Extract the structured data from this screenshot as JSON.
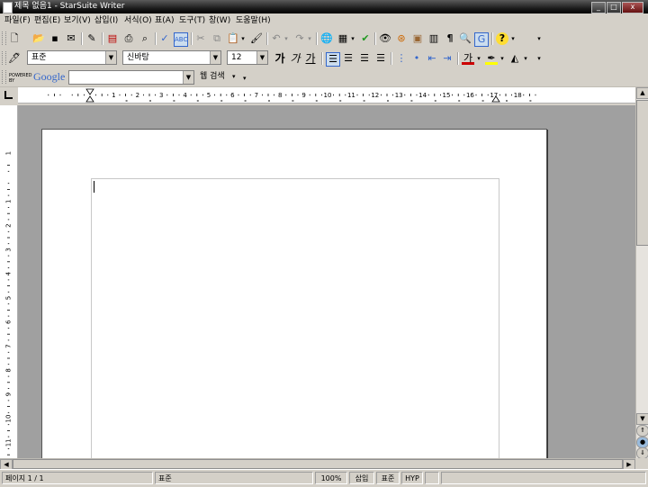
{
  "window": {
    "title": "제목 없음1 - StarSuite Writer"
  },
  "menu": [
    "파일(F)",
    "편집(E)",
    "보기(V)",
    "삽입(I)",
    "서식(O)",
    "표(A)",
    "도구(T)",
    "창(W)",
    "도움말(H)"
  ],
  "format_bar": {
    "style_value": "표준",
    "font_value": "신바탕",
    "size_value": "12",
    "bold_label": "가",
    "italic_label": "가",
    "underline_label": "가"
  },
  "google_bar": {
    "powered_label": "POWERED BY",
    "google_label": "Google",
    "search_value": "",
    "search_button_label": "웹 검색"
  },
  "hruler_labels": [
    "1",
    "2",
    "3",
    "4",
    "5",
    "6",
    "7",
    "8",
    "9",
    "10",
    "11",
    "12",
    "13",
    "14",
    "15",
    "16",
    "17",
    "18"
  ],
  "vruler_labels": [
    "1",
    "1",
    "2",
    "3",
    "4",
    "5",
    "6",
    "7",
    "8",
    "9",
    "10",
    "11"
  ],
  "status": {
    "page": "페이지 1 / 1",
    "style": "표준",
    "zoom": "100%",
    "insert_mode": "삽입",
    "selection_mode": "표준",
    "hyphen": "HYP"
  }
}
